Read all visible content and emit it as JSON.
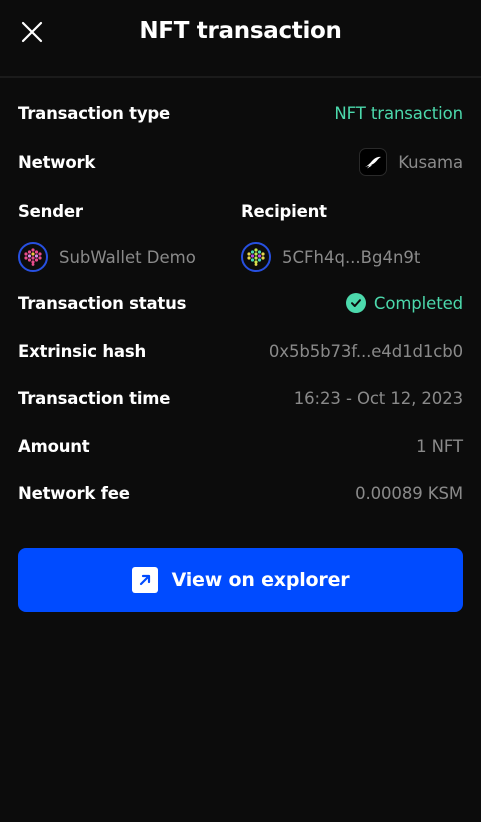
{
  "header": {
    "title": "NFT transaction",
    "close_icon": "close-icon"
  },
  "details": {
    "transaction_type": {
      "label": "Transaction type",
      "value": "NFT transaction"
    },
    "network": {
      "label": "Network",
      "value": "Kusama",
      "icon": "kusama-bird-icon"
    },
    "sender": {
      "label": "Sender",
      "value": "SubWallet Demo"
    },
    "recipient": {
      "label": "Recipient",
      "value": "5CFh4q...Bg4n9t"
    },
    "status": {
      "label": "Transaction status",
      "value": "Completed",
      "icon": "check-circle-icon"
    },
    "extrinsic_hash": {
      "label": "Extrinsic hash",
      "value": "0x5b5b73f...e4d1d1cb0"
    },
    "time": {
      "label": "Transaction time",
      "value": "16:23 - Oct 12, 2023"
    },
    "amount": {
      "label": "Amount",
      "value": "1 NFT"
    },
    "fee": {
      "label": "Network fee",
      "value": "0.00089 KSM"
    }
  },
  "actions": {
    "explorer_label": "View on explorer",
    "explorer_icon": "external-link-icon"
  },
  "colors": {
    "background": "#0c0c0c",
    "accent_green": "#4cd9ac",
    "primary_blue": "#004bff",
    "muted_text": "#8a8a8a"
  }
}
